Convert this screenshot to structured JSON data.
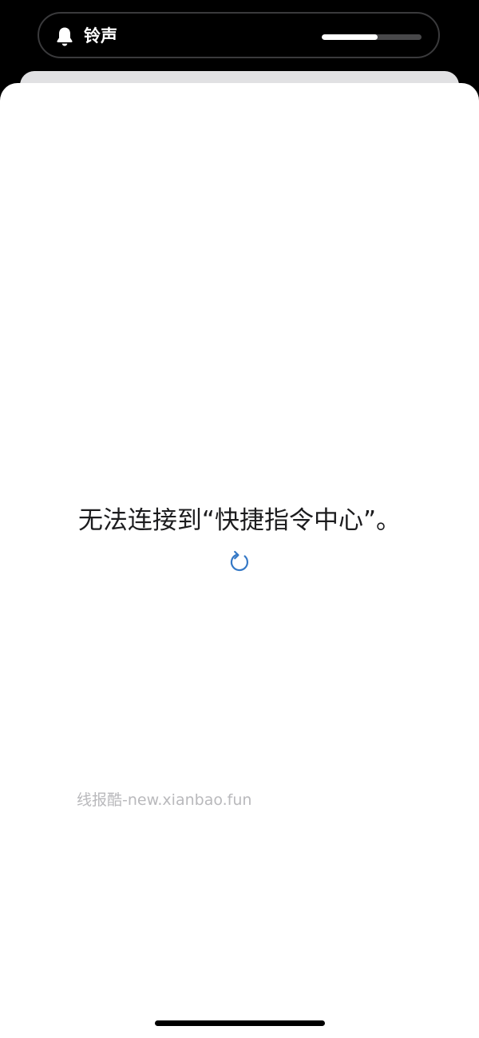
{
  "ringer_hud": {
    "icon": "bell-icon",
    "label": "铃声",
    "volume_level": 0.56
  },
  "content": {
    "error_message": "无法连接到“快捷指令中心”。",
    "reload_icon": "reload-icon",
    "watermark": "线报酷-new.xianbao.fun"
  },
  "colors": {
    "accent": "#3478c6",
    "hud_background": "#000000",
    "sheet_background": "#ffffff"
  }
}
